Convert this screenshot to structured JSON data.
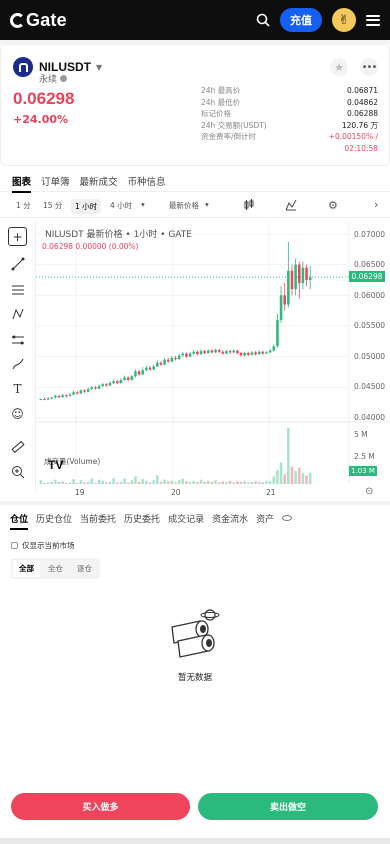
{
  "app": {
    "logo_text": "Gate",
    "deposit_label": "充值"
  },
  "pair": {
    "name": "NILUSDT",
    "type": "永续",
    "price": "0.06298",
    "change": "+24.00%"
  },
  "stats": [
    {
      "label": "24h 最高价",
      "value": "0.06871"
    },
    {
      "label": "24h 最低价",
      "value": "0.04862"
    },
    {
      "label": "标记价格",
      "value": "0.06288"
    },
    {
      "label": "24h 交易额(USDT)",
      "value": "120.76 万"
    },
    {
      "label": "资金费率/倒计时",
      "value": "+0.00150% /"
    },
    {
      "label": "",
      "value": "02:10:58"
    }
  ],
  "tabs": [
    "图表",
    "订单簿",
    "最新成交",
    "币种信息"
  ],
  "toolbar": {
    "t1": "1 分",
    "t2": "15 分",
    "t3": "1 小时",
    "t4": "4 小时",
    "price_type": "最新价格"
  },
  "chart": {
    "title": "NILUSDT 最新价格 • 1小时 • GATE",
    "sub": "0.06298  0.00000 (0.00%)",
    "volume_label": "成交量(Volume)",
    "current_price": "0.06298",
    "current_volume": "1.03 M",
    "y_labels": [
      "0.07000",
      "0.06500",
      "0.06000",
      "0.05500",
      "0.05000",
      "0.04500",
      "0.04000"
    ],
    "vol_labels": [
      "5 M",
      "2.5 M"
    ],
    "x_labels": [
      "19",
      "20",
      "21"
    ]
  },
  "chart_data": {
    "type": "candlestick",
    "title": "NILUSDT 最新价格 • 1小时 • GATE",
    "ylim": [
      0.04,
      0.07
    ],
    "last": 0.06298,
    "x_ticks": [
      "19",
      "20",
      "21"
    ],
    "candles": [
      [
        0.043,
        0.0431,
        0.0432,
        0.0429
      ],
      [
        0.0431,
        0.043,
        0.0433,
        0.0429
      ],
      [
        0.043,
        0.0432,
        0.0434,
        0.0429
      ],
      [
        0.0432,
        0.0433,
        0.0435,
        0.0431
      ],
      [
        0.0433,
        0.0436,
        0.0438,
        0.0432
      ],
      [
        0.0436,
        0.0434,
        0.0437,
        0.0432
      ],
      [
        0.0434,
        0.0437,
        0.0439,
        0.0433
      ],
      [
        0.0437,
        0.0436,
        0.0439,
        0.0434
      ],
      [
        0.0436,
        0.0438,
        0.0441,
        0.0435
      ],
      [
        0.0438,
        0.0442,
        0.0445,
        0.0437
      ],
      [
        0.0442,
        0.044,
        0.0444,
        0.0438
      ],
      [
        0.044,
        0.0445,
        0.0447,
        0.0439
      ],
      [
        0.0445,
        0.0443,
        0.0447,
        0.0441
      ],
      [
        0.0443,
        0.0447,
        0.045,
        0.0442
      ],
      [
        0.0447,
        0.045,
        0.0452,
        0.0446
      ],
      [
        0.045,
        0.0448,
        0.0452,
        0.0446
      ],
      [
        0.0448,
        0.0452,
        0.0455,
        0.0447
      ],
      [
        0.0452,
        0.0455,
        0.0457,
        0.045
      ],
      [
        0.0455,
        0.0453,
        0.0457,
        0.0451
      ],
      [
        0.0453,
        0.0457,
        0.046,
        0.0452
      ],
      [
        0.0457,
        0.046,
        0.0463,
        0.0455
      ],
      [
        0.046,
        0.0457,
        0.0462,
        0.0455
      ],
      [
        0.0457,
        0.0462,
        0.0465,
        0.0456
      ],
      [
        0.0462,
        0.0466,
        0.0469,
        0.0461
      ],
      [
        0.0466,
        0.0462,
        0.0468,
        0.046
      ],
      [
        0.0462,
        0.0468,
        0.047,
        0.0461
      ],
      [
        0.0468,
        0.0476,
        0.0479,
        0.0466
      ],
      [
        0.0476,
        0.0471,
        0.0478,
        0.0469
      ],
      [
        0.0471,
        0.0478,
        0.0483,
        0.047
      ],
      [
        0.0478,
        0.0482,
        0.0485,
        0.0476
      ],
      [
        0.0482,
        0.0479,
        0.0485,
        0.0477
      ],
      [
        0.0479,
        0.0484,
        0.0487,
        0.0478
      ],
      [
        0.0484,
        0.049,
        0.0494,
        0.0483
      ],
      [
        0.049,
        0.0487,
        0.0493,
        0.0485
      ],
      [
        0.0487,
        0.0495,
        0.0498,
        0.0486
      ],
      [
        0.0495,
        0.0492,
        0.0498,
        0.049
      ],
      [
        0.0492,
        0.0498,
        0.0501,
        0.0491
      ],
      [
        0.0498,
        0.0496,
        0.0501,
        0.0494
      ],
      [
        0.0496,
        0.0502,
        0.0505,
        0.0495
      ],
      [
        0.0502,
        0.0505,
        0.0508,
        0.05
      ],
      [
        0.0505,
        0.05,
        0.0507,
        0.0498
      ],
      [
        0.05,
        0.0505,
        0.0508,
        0.0499
      ],
      [
        0.0505,
        0.0508,
        0.0511,
        0.0503
      ],
      [
        0.0508,
        0.0504,
        0.051,
        0.0502
      ],
      [
        0.0504,
        0.0509,
        0.0512,
        0.0503
      ],
      [
        0.0509,
        0.0506,
        0.0511,
        0.0504
      ],
      [
        0.0506,
        0.051,
        0.0512,
        0.0505
      ],
      [
        0.051,
        0.0507,
        0.0512,
        0.0505
      ],
      [
        0.0507,
        0.0511,
        0.0513,
        0.0506
      ],
      [
        0.0511,
        0.0508,
        0.0513,
        0.0506
      ],
      [
        0.0508,
        0.0505,
        0.051,
        0.0503
      ],
      [
        0.0505,
        0.0509,
        0.0511,
        0.0504
      ],
      [
        0.0509,
        0.0507,
        0.0511,
        0.0505
      ],
      [
        0.0507,
        0.051,
        0.0512,
        0.0506
      ],
      [
        0.051,
        0.0506,
        0.0511,
        0.0504
      ],
      [
        0.0506,
        0.0502,
        0.0508,
        0.05
      ],
      [
        0.0502,
        0.0506,
        0.0508,
        0.0501
      ],
      [
        0.0506,
        0.0503,
        0.0508,
        0.0501
      ],
      [
        0.0503,
        0.0507,
        0.0509,
        0.0502
      ],
      [
        0.0507,
        0.0504,
        0.0509,
        0.0502
      ],
      [
        0.0504,
        0.0508,
        0.051,
        0.0503
      ],
      [
        0.0508,
        0.0505,
        0.051,
        0.0503
      ],
      [
        0.0505,
        0.0507,
        0.0509,
        0.0504
      ],
      [
        0.0507,
        0.051,
        0.0512,
        0.0506
      ],
      [
        0.051,
        0.0517,
        0.052,
        0.0509
      ],
      [
        0.0517,
        0.056,
        0.057,
        0.0515
      ],
      [
        0.056,
        0.06,
        0.0615,
        0.0555
      ],
      [
        0.06,
        0.0585,
        0.062,
        0.0575
      ],
      [
        0.0585,
        0.064,
        0.0687,
        0.058
      ],
      [
        0.064,
        0.061,
        0.065,
        0.06
      ],
      [
        0.061,
        0.065,
        0.066,
        0.06
      ],
      [
        0.065,
        0.062,
        0.0655,
        0.0595
      ],
      [
        0.062,
        0.0645,
        0.0655,
        0.061
      ],
      [
        0.0645,
        0.0625,
        0.065,
        0.0615
      ],
      [
        0.0625,
        0.063,
        0.0648,
        0.061
      ]
    ],
    "volume_ylim": [
      0,
      5000000
    ],
    "volume": [
      0.35,
      0.1,
      0.15,
      0.2,
      0.4,
      0.2,
      0.25,
      0.1,
      0.15,
      0.45,
      0.1,
      0.35,
      0.15,
      0.2,
      0.5,
      0.1,
      0.4,
      0.3,
      0.15,
      0.2,
      0.55,
      0.15,
      0.2,
      0.5,
      0.15,
      0.35,
      0.7,
      0.2,
      0.45,
      0.3,
      0.15,
      0.35,
      0.8,
      0.2,
      0.4,
      0.25,
      0.3,
      0.15,
      0.35,
      0.5,
      0.25,
      0.2,
      0.3,
      0.2,
      0.4,
      0.2,
      0.3,
      0.2,
      0.35,
      0.15,
      0.25,
      0.2,
      0.3,
      0.15,
      0.25,
      0.2,
      0.3,
      0.15,
      0.2,
      0.25,
      0.2,
      0.15,
      0.3,
      0.25,
      0.7,
      1.3,
      2.0,
      0.9,
      5.2,
      1.6,
      1.2,
      1.5,
      1.0,
      0.8,
      1.03
    ]
  },
  "bottom_tabs": [
    "仓位",
    "历史仓位",
    "当前委托",
    "历史委托",
    "成交记录",
    "资金流水",
    "资产"
  ],
  "only_current": "仅显示当前市场",
  "segments": [
    "全部",
    "全仓",
    "逐仓"
  ],
  "empty_text": "暂无数据",
  "buttons": {
    "buy": "买入做多",
    "sell": "卖出做空"
  },
  "colors": {
    "up": "#2bba7e",
    "down": "#f0435c",
    "brand": "#1460f5"
  }
}
